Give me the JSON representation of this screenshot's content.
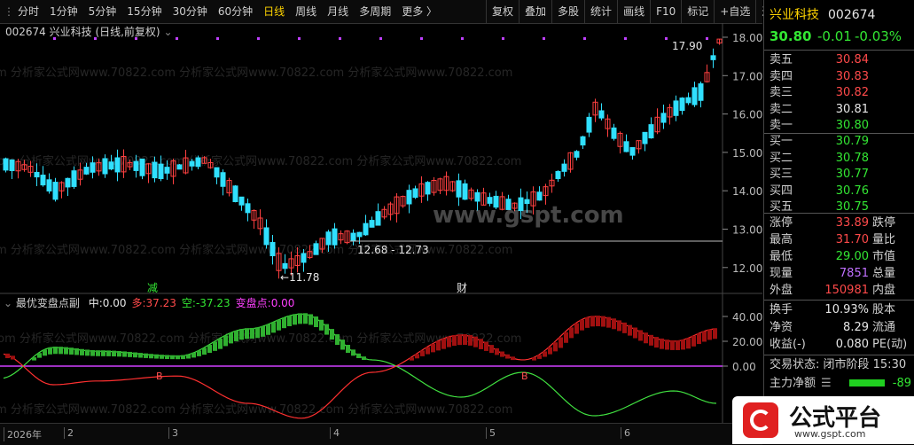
{
  "topbar": {
    "tabs": [
      "分时",
      "1分钟",
      "5分钟",
      "15分钟",
      "30分钟",
      "60分钟",
      "日线",
      "周线",
      "月线",
      "多周期",
      "更多 〉"
    ],
    "active_index": 6,
    "right_tools": [
      "复权",
      "叠加",
      "多股",
      "统计",
      "画线",
      "F10",
      "标记",
      "+自选",
      "返回"
    ]
  },
  "chart": {
    "title": "002674 兴业科技 (日线,前复权)",
    "y_ticks": [
      "18.00",
      "17.00",
      "16.00",
      "15.00",
      "14.00",
      "13.00",
      "12.00"
    ],
    "annotations": {
      "high": "17.90",
      "low": "11.78",
      "range": "12.68 - 12.73"
    },
    "markers": [
      "减",
      "财"
    ],
    "watermark": "com 分析家公式网www.70822.com 分析家公式网www.70822.com 分析家公式网www.70822.com"
  },
  "sub_chart": {
    "title": "最优变盘点副",
    "items": [
      {
        "label": "中:",
        "value": "0.00",
        "color": "#e6e6e6"
      },
      {
        "label": "多:",
        "value": "37.23",
        "color": "#ff4a4a"
      },
      {
        "label": "空:",
        "value": "-37.23",
        "color": "#33e633"
      },
      {
        "label": "变盘点:",
        "value": "0.00",
        "color": "#ff40ff"
      }
    ],
    "y_ticks": [
      "40.00",
      "20.00",
      "0.00"
    ]
  },
  "timeline": {
    "labels": [
      "2026年",
      "2",
      "3",
      "4",
      "5",
      "6"
    ]
  },
  "quote": {
    "name": "兴业科技",
    "code": "002674",
    "price": "30.80",
    "change": "-0.01",
    "change_pct": "-0.03%",
    "asks": [
      {
        "label": "卖五",
        "price": "30.84",
        "color": "red"
      },
      {
        "label": "卖四",
        "price": "30.83",
        "color": "red"
      },
      {
        "label": "卖三",
        "price": "30.82",
        "color": "red"
      },
      {
        "label": "卖二",
        "price": "30.81",
        "color": "white"
      },
      {
        "label": "卖一",
        "price": "30.80",
        "color": "green"
      }
    ],
    "bids": [
      {
        "label": "买一",
        "price": "30.79",
        "color": "green"
      },
      {
        "label": "买二",
        "price": "30.78",
        "color": "green"
      },
      {
        "label": "买三",
        "price": "30.77",
        "color": "green"
      },
      {
        "label": "买四",
        "price": "30.76",
        "color": "green"
      },
      {
        "label": "买五",
        "price": "30.75",
        "color": "green"
      }
    ],
    "stats": [
      {
        "label": "涨停",
        "value": "33.89",
        "color": "red",
        "label2": "跌停"
      },
      {
        "label": "最高",
        "value": "31.70",
        "color": "red",
        "label2": "量比"
      },
      {
        "label": "最低",
        "value": "29.00",
        "color": "green",
        "label2": "市值"
      },
      {
        "label": "现量",
        "value": "7851",
        "color": "purple",
        "label2": "总量"
      },
      {
        "label": "外盘",
        "value": "150981",
        "color": "red",
        "label2": "内盘"
      }
    ],
    "stats2": [
      {
        "label": "换手",
        "value": "10.93%",
        "label2": "股本"
      },
      {
        "label": "净资",
        "value": "8.29",
        "label2": "流通"
      },
      {
        "label": "收益(-)",
        "value": "0.080",
        "label2": "PE(动)"
      }
    ],
    "trade_status": "交易状态: 闭市阶段 15:30",
    "main_flow_label": "主力净额",
    "main_flow_value": "-89"
  },
  "logo": {
    "title": "公式平台",
    "url": "www.gspt.com"
  },
  "center_watermark": "www.gspt.com"
}
